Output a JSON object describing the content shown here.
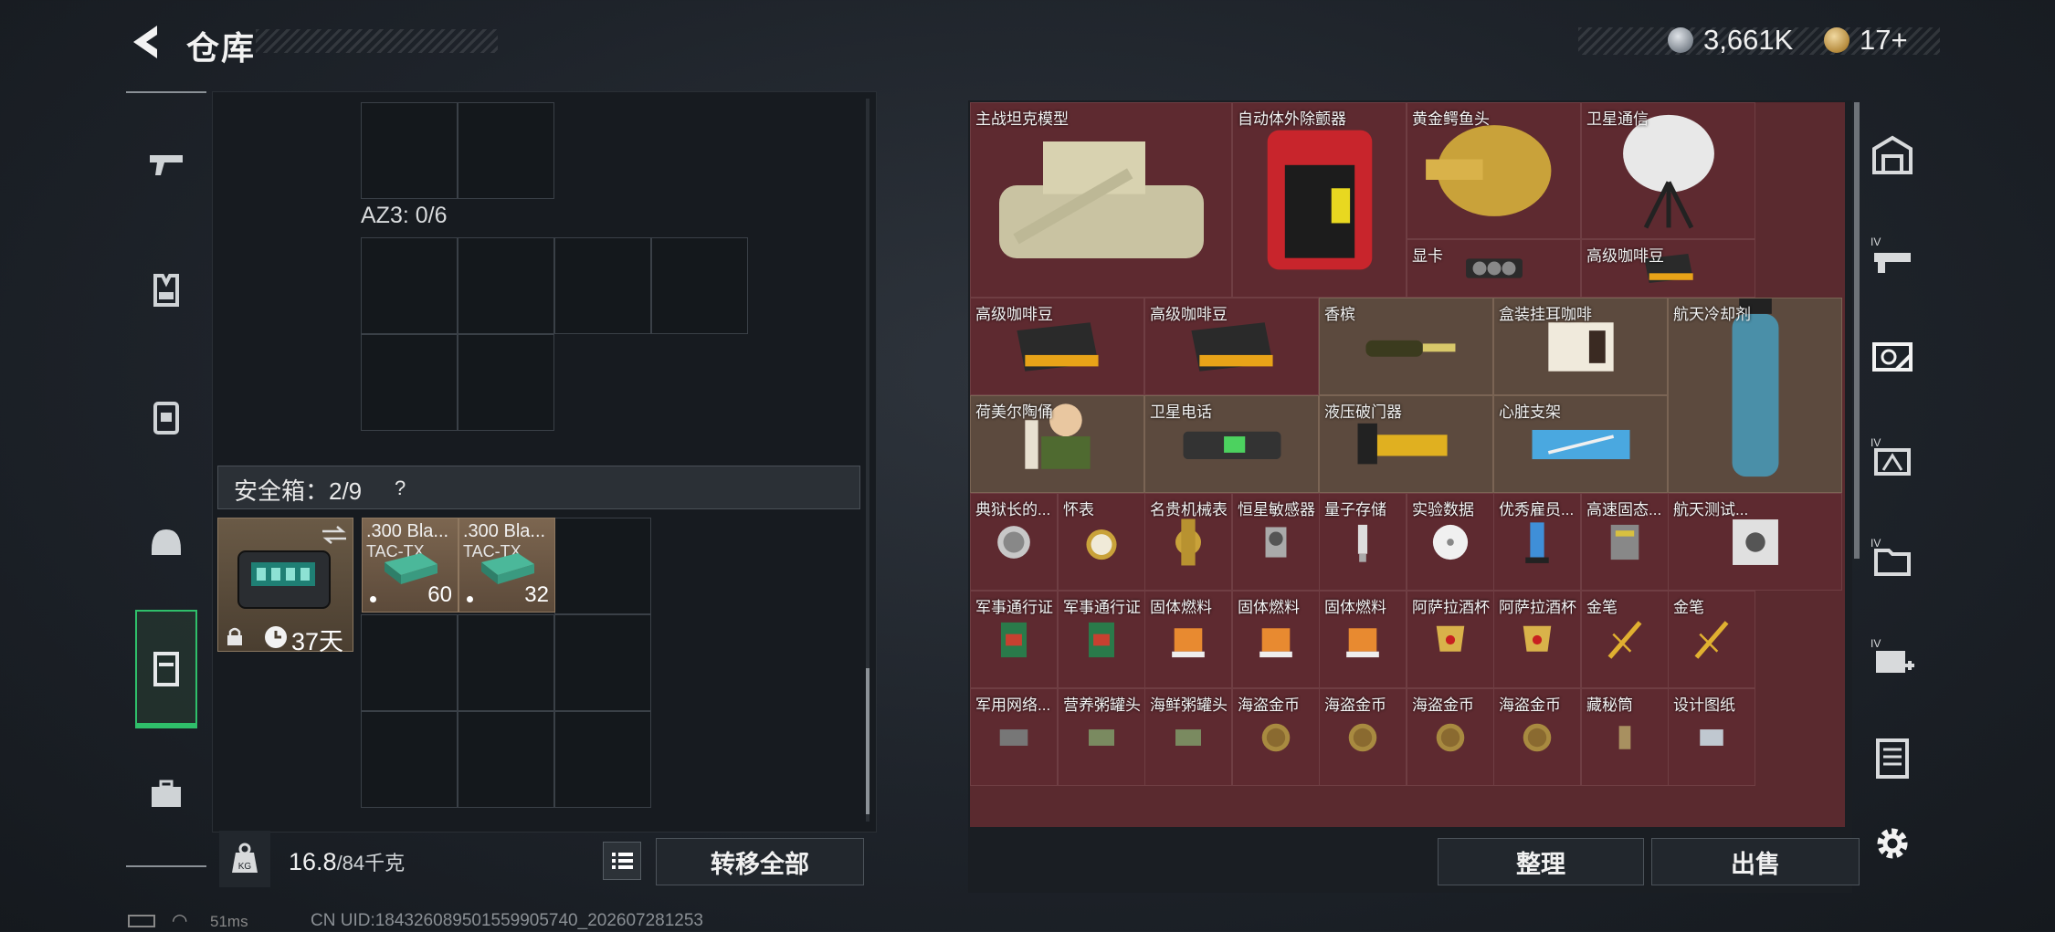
{
  "header": {
    "title": "仓库",
    "currency1": "3,661K",
    "currency2": "17+"
  },
  "left_panel": {
    "az3_label": "AZ3: 0/6",
    "safe_label": "安全箱：2/9",
    "safe_help": "?",
    "safe_items": [
      {
        "name": ".300 Bla...",
        "sub": "TAC-TX",
        "count": "60"
      },
      {
        "name": ".300 Bla...",
        "sub": "TAC-TX",
        "count": "32"
      }
    ],
    "box_timer": "37天",
    "weight_current": "16.8",
    "weight_max": "/84千克",
    "weight_icon_label": "KG",
    "transfer_all": "转移全部"
  },
  "grid": {
    "items": [
      {
        "label": "主战坦克模型",
        "icon": "tank"
      },
      {
        "label": "自动体外除颤器",
        "icon": "aed"
      },
      {
        "label": "黄金鳄鱼头",
        "icon": "gold-croc"
      },
      {
        "label": "卫星通信",
        "icon": "sat-dish"
      },
      {
        "label": "显卡",
        "icon": "gpu"
      },
      {
        "label": "高级咖啡豆",
        "icon": "coffee"
      },
      {
        "label": "高级咖啡豆",
        "icon": "coffee"
      },
      {
        "label": "高级咖啡豆",
        "icon": "coffee"
      },
      {
        "label": "香槟",
        "icon": "champagne"
      },
      {
        "label": "盒装挂耳咖啡",
        "icon": "coffee-box"
      },
      {
        "label": "航天冷却剂",
        "icon": "coolant"
      },
      {
        "label": "荷美尔陶俑",
        "icon": "figurine"
      },
      {
        "label": "卫星电话",
        "icon": "sat-phone"
      },
      {
        "label": "液压破门器",
        "icon": "breacher"
      },
      {
        "label": "心脏支架",
        "icon": "stent"
      },
      {
        "label": "典狱长的...",
        "icon": "medal"
      },
      {
        "label": "怀表",
        "icon": "pocket-watch"
      },
      {
        "label": "名贵机械表",
        "icon": "watch"
      },
      {
        "label": "恒星敏感器",
        "icon": "sensor"
      },
      {
        "label": "量子存储",
        "icon": "usb"
      },
      {
        "label": "实验数据",
        "icon": "disc"
      },
      {
        "label": "优秀雇员...",
        "icon": "trophy"
      },
      {
        "label": "高速固态...",
        "icon": "ssd"
      },
      {
        "label": "航天测试...",
        "icon": "test-device"
      },
      {
        "label": "军事通行证",
        "icon": "pass"
      },
      {
        "label": "军事通行证",
        "icon": "pass"
      },
      {
        "label": "固体燃料",
        "icon": "fuel"
      },
      {
        "label": "固体燃料",
        "icon": "fuel"
      },
      {
        "label": "固体燃料",
        "icon": "fuel"
      },
      {
        "label": "阿萨拉酒杯",
        "icon": "cup"
      },
      {
        "label": "阿萨拉酒杯",
        "icon": "cup"
      },
      {
        "label": "金笔",
        "icon": "pen"
      },
      {
        "label": "金笔",
        "icon": "pen"
      },
      {
        "label": "军用网络...",
        "icon": "net"
      },
      {
        "label": "营养粥罐头",
        "icon": "can"
      },
      {
        "label": "海鲜粥罐头",
        "icon": "can"
      },
      {
        "label": "海盗金币",
        "icon": "coin"
      },
      {
        "label": "海盗金币",
        "icon": "coin"
      },
      {
        "label": "海盗金币",
        "icon": "coin"
      },
      {
        "label": "海盗金币",
        "icon": "coin"
      },
      {
        "label": "藏秘筒",
        "icon": "tube"
      },
      {
        "label": "设计图纸",
        "icon": "blueprint"
      }
    ]
  },
  "buttons": {
    "sort": "整理",
    "sell": "出售"
  },
  "status": {
    "ping": "51ms",
    "uid": "CN UID:18432608950155990574​0_202607281253"
  },
  "colors": {
    "valuable_bg": "#5e2a30",
    "common_bg": "#5c4a3e",
    "accent": "#2fbf6a"
  }
}
